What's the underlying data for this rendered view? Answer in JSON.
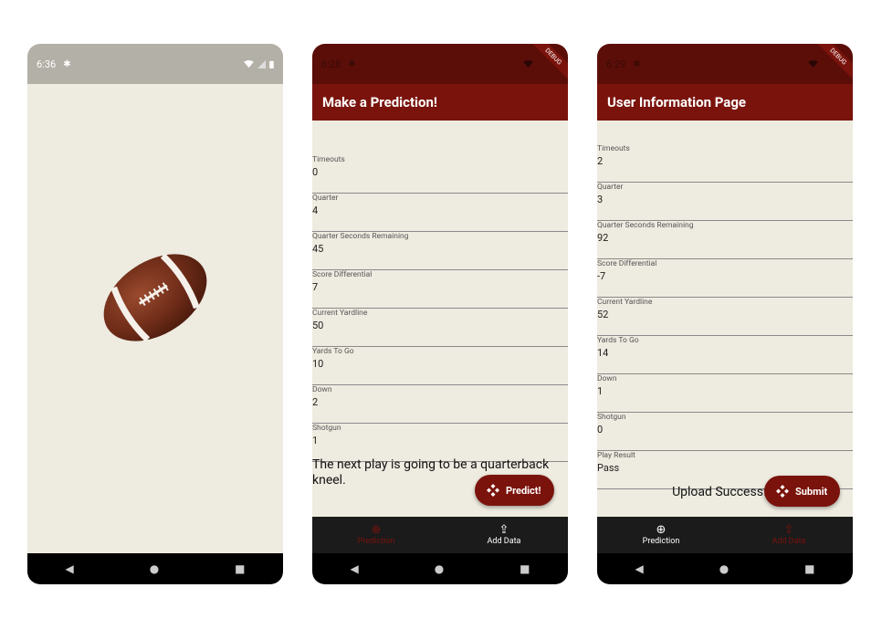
{
  "screen1": {
    "time": "6:36"
  },
  "screen2": {
    "time": "6:28",
    "debug": "DEBUG",
    "title": "Make a Prediction!",
    "fields": [
      {
        "label": "Timeouts",
        "value": "0"
      },
      {
        "label": "Quarter",
        "value": "4"
      },
      {
        "label": "Quarter Seconds Remaining",
        "value": "45"
      },
      {
        "label": "Score Differential",
        "value": "7"
      },
      {
        "label": "Current Yardline",
        "value": "50"
      },
      {
        "label": "Yards To Go",
        "value": "10"
      },
      {
        "label": "Down",
        "value": "2"
      },
      {
        "label": "Shotgun",
        "value": "1"
      }
    ],
    "result": "The next play is going to be a quarterback kneel.",
    "fab": "Predict!",
    "nav": [
      {
        "label": "Prediction"
      },
      {
        "label": "Add Data"
      }
    ]
  },
  "screen3": {
    "time": "6:29",
    "debug": "DEBUG",
    "title": "User Information Page",
    "fields": [
      {
        "label": "Timeouts",
        "value": "2"
      },
      {
        "label": "Quarter",
        "value": "3"
      },
      {
        "label": "Quarter Seconds Remaining",
        "value": "92"
      },
      {
        "label": "Score Differential",
        "value": "-7"
      },
      {
        "label": "Current Yardline",
        "value": "52"
      },
      {
        "label": "Yards To Go",
        "value": "14"
      },
      {
        "label": "Down",
        "value": "1"
      },
      {
        "label": "Shotgun",
        "value": "0"
      },
      {
        "label": "Play Result",
        "value": "Pass"
      }
    ],
    "upload": "Upload Successful",
    "fab": "Submit",
    "nav": [
      {
        "label": "Prediction"
      },
      {
        "label": "Add Data"
      }
    ]
  },
  "colors": {
    "accent": "#7A130C",
    "background": "#EEEBE0",
    "statusbar": "#5B0E08",
    "bottomnav": "#1B1B1B"
  }
}
